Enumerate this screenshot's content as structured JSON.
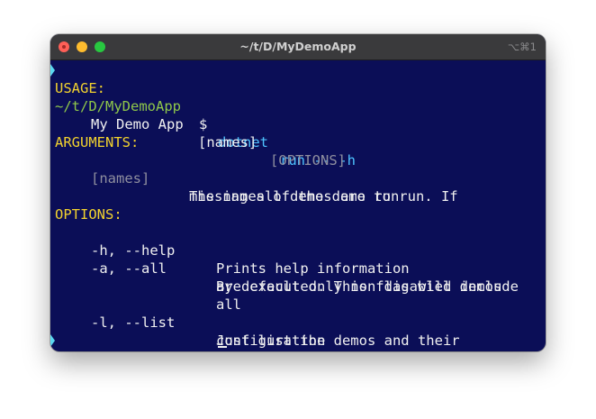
{
  "window": {
    "title": "~/t/D/MyDemoApp",
    "shortcut": "⌥⌘1",
    "colors": {
      "close": "#fe5f57",
      "minimize": "#febc2e",
      "maximize": "#28c840"
    }
  },
  "terminal": {
    "prompt_path": "~/t/D/MyDemoApp",
    "prompt_symbol": "$",
    "command_name": "dotnet",
    "command_args": "run -- -h",
    "usage": {
      "header": "USAGE:",
      "app": "My Demo App",
      "names": "[names]",
      "options": "[OPTIONS]"
    },
    "arguments": {
      "header": "ARGUMENTS:",
      "items": [
        {
          "name": "[names]",
          "desc_lines": [
            "The names of the demo to run. If",
            "missing all demos are run"
          ]
        }
      ]
    },
    "options": {
      "header": "OPTIONS:",
      "items": [
        {
          "flag": "-h, --help",
          "desc_lines": [
            "Prints help information"
          ]
        },
        {
          "flag": "-a, --all",
          "desc_lines": [
            "By default only non disabled demos",
            "are executed. This flag will include",
            "all"
          ]
        },
        {
          "flag": "-l, --list",
          "desc_lines": [
            "Just list the demos and their",
            "configuration"
          ]
        }
      ]
    }
  }
}
